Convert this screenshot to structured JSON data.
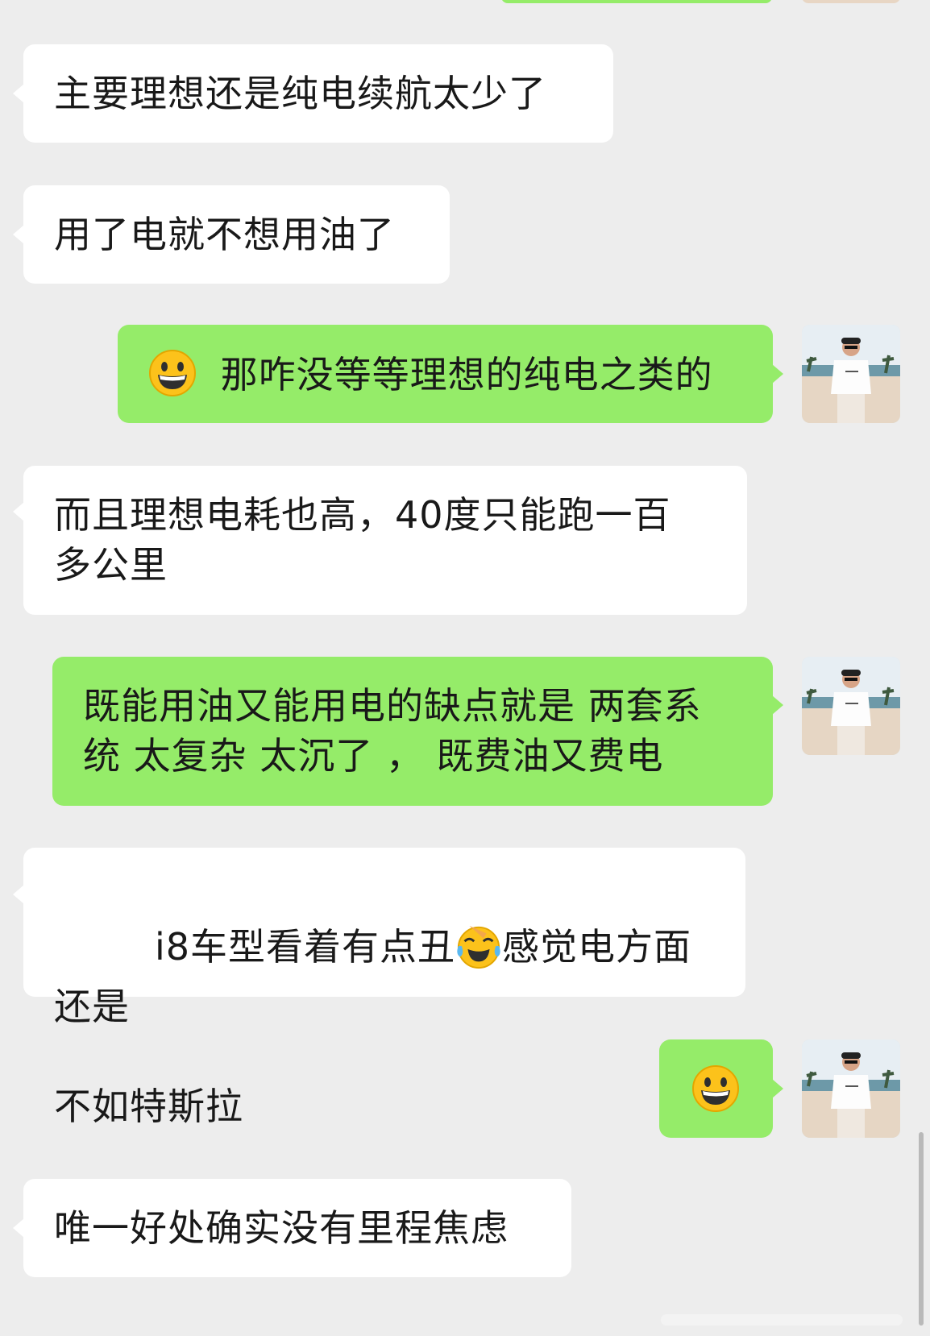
{
  "messages": [
    {
      "side": "in",
      "text": "主要理想还是纯电续航太少了"
    },
    {
      "side": "in",
      "text": "用了电就不想用油了"
    },
    {
      "side": "out",
      "prefix_emoji": "grinning-face",
      "text": "那咋没等等理想的纯电之类的"
    },
    {
      "side": "in",
      "line1": "而且理想电耗也高，40度只能跑一百",
      "line2": "多公里"
    },
    {
      "side": "out",
      "line1": "既能用油又能用电的缺点就是 两套系",
      "line2": "统 太复杂 太沉了 ， 既费油又费电"
    },
    {
      "side": "in",
      "part1": "i8车型看着有点丑",
      "inline_emoji": "face-with-tears-of-joy",
      "part2": "感觉电方面还是",
      "line2": "不如特斯拉"
    },
    {
      "side": "out",
      "emoji_only": "grinning-face"
    },
    {
      "side": "in",
      "text": "唯一好处确实没有里程焦虑"
    }
  ],
  "colors": {
    "background": "#ededed",
    "incoming_bubble": "#ffffff",
    "outgoing_bubble": "#95ec69",
    "text": "#191919"
  }
}
